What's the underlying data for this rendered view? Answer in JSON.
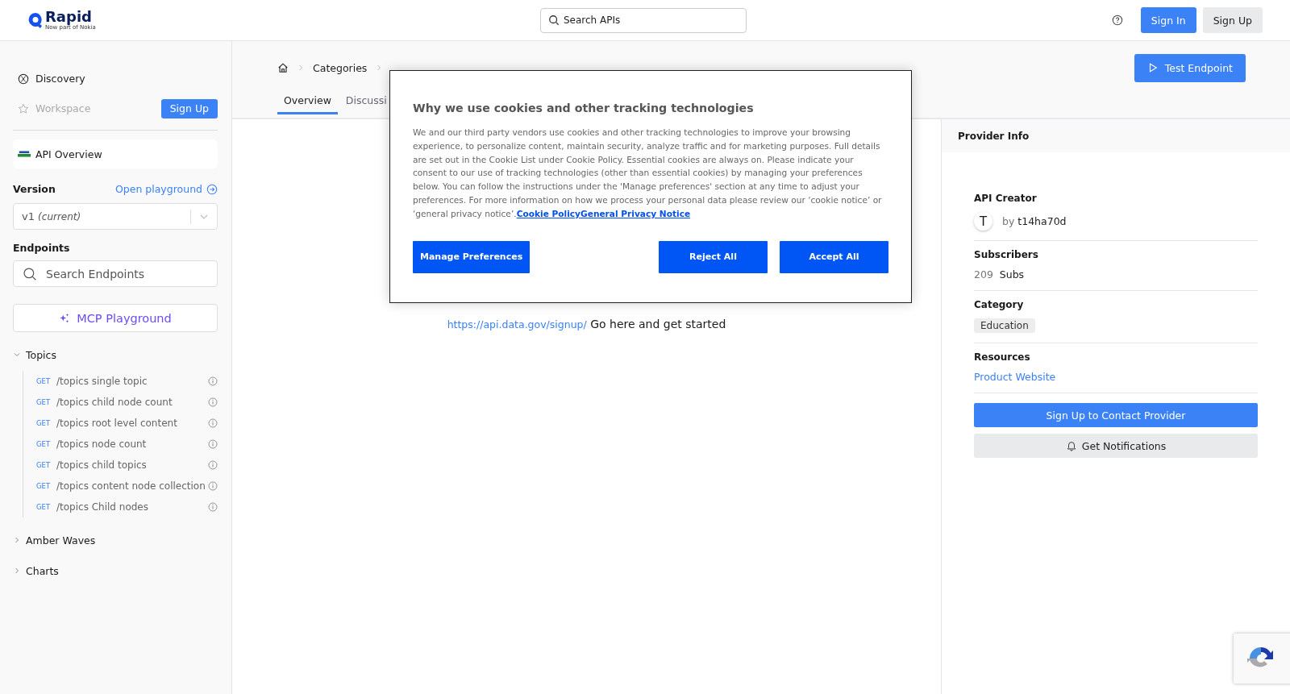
{
  "header": {
    "logo": "Rapid",
    "logo_tagline": "Now part of Nokia",
    "search": {
      "placeholder": "Search APIs"
    },
    "buttons": [
      {
        "label": "Sign In",
        "kind": "primary"
      },
      {
        "label": "Sign Up",
        "kind": "secondary"
      }
    ]
  },
  "sidebar": {
    "nav": [
      {
        "label": "Discovery",
        "kind": "discovery",
        "disabled": false
      },
      {
        "label": "Workspace",
        "kind": "workspace",
        "disabled": true
      }
    ],
    "workspace_button": "Sign Up",
    "api_overview": "API Overview",
    "version": {
      "label": "Version",
      "playground_link": "Open playground",
      "value": "v1",
      "value_note": "(current)"
    },
    "endpoints": {
      "label": "Endpoints",
      "search": {
        "placeholder": "Search Endpoints"
      }
    },
    "mcp_button": "MCP Playground",
    "groups": [
      {
        "label": "Topics",
        "expanded": true,
        "children": [
          {
            "method": "GET",
            "path": "/topics single topic"
          },
          {
            "method": "GET",
            "path": "/topics child node count"
          },
          {
            "method": "GET",
            "path": "/topics root level content"
          },
          {
            "method": "GET",
            "path": "/topics node count"
          },
          {
            "method": "GET",
            "path": "/topics child topics"
          },
          {
            "method": "GET",
            "path": "/topics content node collection"
          },
          {
            "method": "GET",
            "path": "/topics Child nodes"
          }
        ]
      },
      {
        "label": "Amber Waves",
        "expanded": false
      },
      {
        "label": "Charts",
        "expanded": false
      }
    ]
  },
  "main": {
    "breadcrumb": [
      "Categories"
    ],
    "test_button": "Test Endpoint",
    "tabs": [
      {
        "label": "Overview",
        "selected": true
      },
      {
        "label": "Discussi",
        "selected": false
      }
    ],
    "content": {
      "link": "https://api.data.gov/signup/",
      "text": "Go here and get started"
    }
  },
  "provider": {
    "title": "Provider Info",
    "creator_label": "API Creator",
    "avatar": "T",
    "creator_by": "by",
    "creator": "t14ha70d",
    "subscribers_label": "Subscribers",
    "subscribers": "209",
    "subscribers_unit": "Subs",
    "category_label": "Category",
    "category": "Education",
    "resources_label": "Resources",
    "resource_link": "Product Website",
    "contact_button": "Sign Up to Contact Provider",
    "notify_button": "Get Notifications"
  },
  "cookie_dialog": {
    "title": "Why we use cookies and other tracking technologies",
    "body": "We and our third party vendors use cookies and other tracking technologies to improve your browsing experience, to personalize content, maintain security, analyze traffic and for marketing purposes. Full details are set out in the Cookie List under Cookie Policy. Essential cookies are always on. Please indicate your consent to our use of tracking technologies (other than essential cookies) by managing your preferences below. You can follow the instructions under the 'Manage preferences' section at any time to adjust your preferences. For more information on how we process your personal data please review our ‘cookie notice’ or ‘general privacy notice’.",
    "links": [
      "Cookie Policy",
      "General Privacy Notice"
    ],
    "buttons": [
      "Manage Preferences",
      "Reject All",
      "Accept All"
    ]
  }
}
